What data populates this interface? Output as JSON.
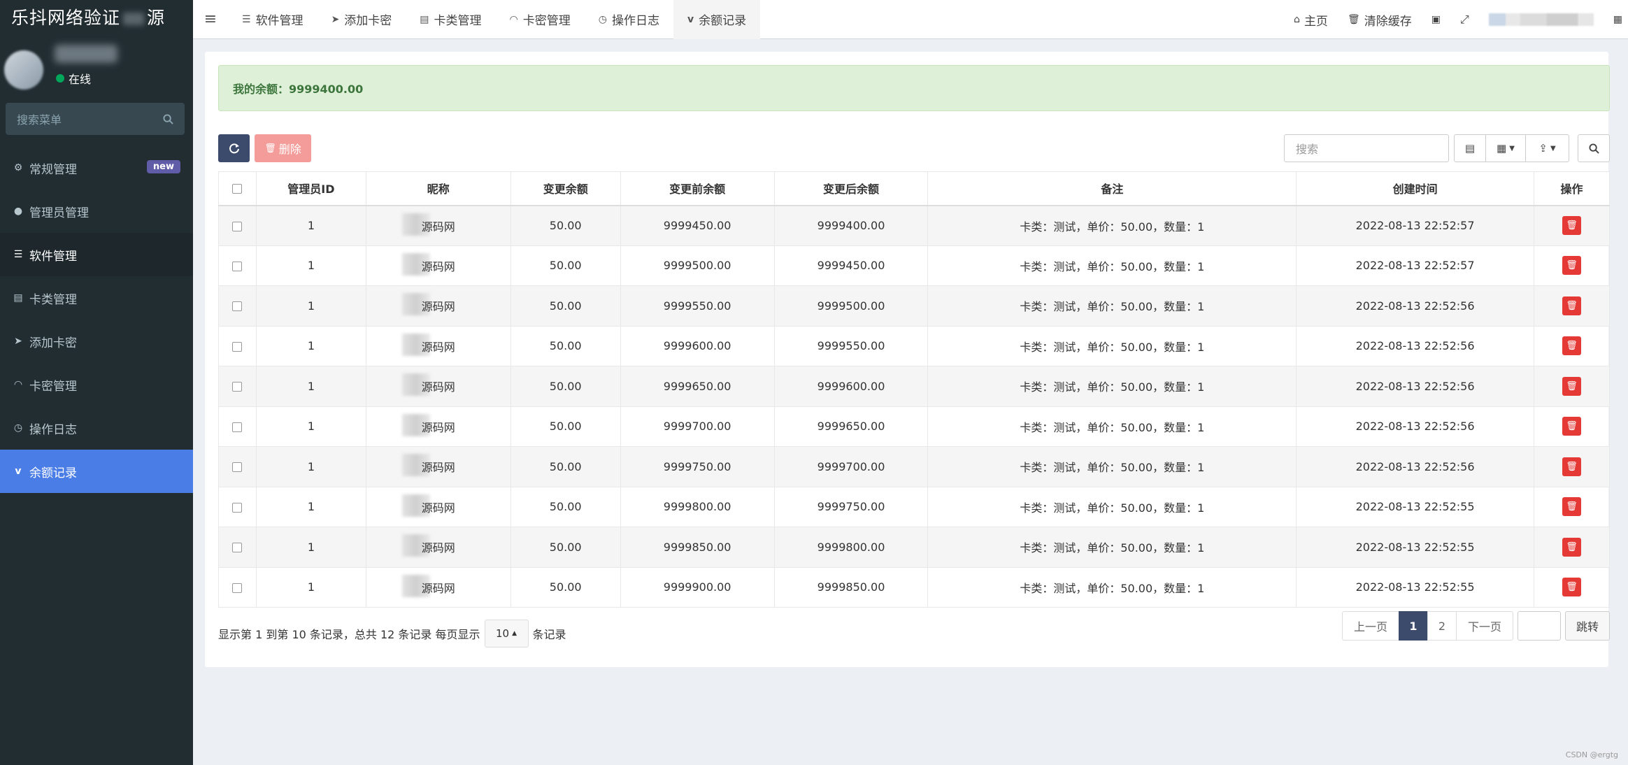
{
  "brand": "乐抖网络验证",
  "brand_tail": "源",
  "user": {
    "status": "在线"
  },
  "sidebar": {
    "search_placeholder": "搜索菜单",
    "items": [
      {
        "label": "常规管理",
        "icon": "cogs-icon",
        "badge": "new"
      },
      {
        "label": "管理员管理",
        "icon": "user-icon"
      },
      {
        "label": "软件管理",
        "icon": "table-icon"
      },
      {
        "label": "卡类管理",
        "icon": "list-icon"
      },
      {
        "label": "添加卡密",
        "icon": "paper-plane-icon"
      },
      {
        "label": "卡密管理",
        "icon": "rss-icon"
      },
      {
        "label": "操作日志",
        "icon": "clock-icon"
      },
      {
        "label": "余额记录",
        "icon": "vimeo-icon"
      }
    ]
  },
  "topnav": {
    "tabs": [
      "软件管理",
      "添加卡密",
      "卡类管理",
      "卡密管理",
      "操作日志",
      "余额记录"
    ],
    "home": "主页",
    "clear_cache": "清除缓存"
  },
  "balance": {
    "text": "我的余额：9999400.00"
  },
  "toolbar": {
    "delete_label": "删除",
    "search_placeholder": "搜索"
  },
  "table": {
    "headers": [
      "管理员ID",
      "昵称",
      "变更余额",
      "变更前余额",
      "变更后余额",
      "备注",
      "创建时间",
      "操作"
    ],
    "rows": [
      {
        "admin_id": "1",
        "nick": "源码网",
        "change": "50.00",
        "before": "9999450.00",
        "after": "9999400.00",
        "remark": "卡类：测试，单价：50.00，数量：1",
        "time": "2022-08-13 22:52:57"
      },
      {
        "admin_id": "1",
        "nick": "源码网",
        "change": "50.00",
        "before": "9999500.00",
        "after": "9999450.00",
        "remark": "卡类：测试，单价：50.00，数量：1",
        "time": "2022-08-13 22:52:57"
      },
      {
        "admin_id": "1",
        "nick": "源码网",
        "change": "50.00",
        "before": "9999550.00",
        "after": "9999500.00",
        "remark": "卡类：测试，单价：50.00，数量：1",
        "time": "2022-08-13 22:52:56"
      },
      {
        "admin_id": "1",
        "nick": "源码网",
        "change": "50.00",
        "before": "9999600.00",
        "after": "9999550.00",
        "remark": "卡类：测试，单价：50.00，数量：1",
        "time": "2022-08-13 22:52:56"
      },
      {
        "admin_id": "1",
        "nick": "源码网",
        "change": "50.00",
        "before": "9999650.00",
        "after": "9999600.00",
        "remark": "卡类：测试，单价：50.00，数量：1",
        "time": "2022-08-13 22:52:56"
      },
      {
        "admin_id": "1",
        "nick": "源码网",
        "change": "50.00",
        "before": "9999700.00",
        "after": "9999650.00",
        "remark": "卡类：测试，单价：50.00，数量：1",
        "time": "2022-08-13 22:52:56"
      },
      {
        "admin_id": "1",
        "nick": "源码网",
        "change": "50.00",
        "before": "9999750.00",
        "after": "9999700.00",
        "remark": "卡类：测试，单价：50.00，数量：1",
        "time": "2022-08-13 22:52:56"
      },
      {
        "admin_id": "1",
        "nick": "源码网",
        "change": "50.00",
        "before": "9999800.00",
        "after": "9999750.00",
        "remark": "卡类：测试，单价：50.00，数量：1",
        "time": "2022-08-13 22:52:55"
      },
      {
        "admin_id": "1",
        "nick": "源码网",
        "change": "50.00",
        "before": "9999850.00",
        "after": "9999800.00",
        "remark": "卡类：测试，单价：50.00，数量：1",
        "time": "2022-08-13 22:52:55"
      },
      {
        "admin_id": "1",
        "nick": "源码网",
        "change": "50.00",
        "before": "9999900.00",
        "after": "9999850.00",
        "remark": "卡类：测试，单价：50.00，数量：1",
        "time": "2022-08-13 22:52:55"
      }
    ]
  },
  "pagination": {
    "info": "显示第 1 到第 10 条记录，总共 12 条记录 每页显示",
    "page_size": "10",
    "suffix": "条记录",
    "prev": "上一页",
    "pages": [
      "1",
      "2"
    ],
    "next": "下一页",
    "jump": "跳转"
  },
  "watermark": "CSDN @ergtg"
}
